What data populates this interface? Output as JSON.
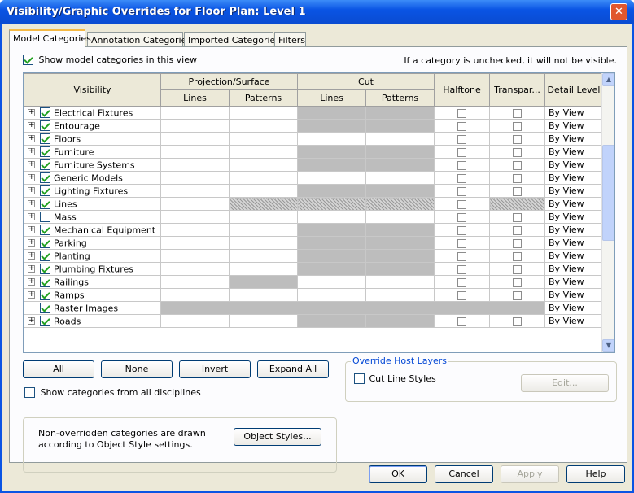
{
  "window": {
    "title": "Visibility/Graphic Overrides for Floor Plan: Level 1",
    "close_glyph": "✕"
  },
  "tabs": [
    "Model Categories",
    "Annotation Categories",
    "Imported Categories",
    "Filters"
  ],
  "show_model": {
    "label": "Show model categories in this view",
    "checked": true
  },
  "hint": "If a category is unchecked, it will not be visible.",
  "headers": {
    "visibility": "Visibility",
    "projection_surface": "Projection/Surface",
    "cut": "Cut",
    "lines": "Lines",
    "patterns": "Patterns",
    "halftone": "Halftone",
    "transparency": "Transpar...",
    "detail_level": "Detail Level"
  },
  "rows": [
    {
      "name": "Electrical Fixtures",
      "checked": true,
      "expand": true,
      "cut": "gray",
      "proj_pat": "",
      "halftone": true,
      "transp": true,
      "detail": "By View"
    },
    {
      "name": "Entourage",
      "checked": true,
      "expand": true,
      "cut": "gray",
      "proj_pat": "",
      "halftone": true,
      "transp": true,
      "detail": "By View"
    },
    {
      "name": "Floors",
      "checked": true,
      "expand": true,
      "cut": "",
      "proj_pat": "",
      "halftone": true,
      "transp": true,
      "detail": "By View"
    },
    {
      "name": "Furniture",
      "checked": true,
      "expand": true,
      "cut": "gray",
      "proj_pat": "",
      "halftone": true,
      "transp": true,
      "detail": "By View"
    },
    {
      "name": "Furniture Systems",
      "checked": true,
      "expand": true,
      "cut": "gray",
      "proj_pat": "",
      "halftone": true,
      "transp": true,
      "detail": "By View"
    },
    {
      "name": "Generic Models",
      "checked": true,
      "expand": true,
      "cut": "",
      "proj_pat": "",
      "halftone": true,
      "transp": true,
      "detail": "By View"
    },
    {
      "name": "Lighting Fixtures",
      "checked": true,
      "expand": true,
      "cut": "gray",
      "proj_pat": "",
      "halftone": true,
      "transp": true,
      "detail": "By View"
    },
    {
      "name": "Lines",
      "checked": true,
      "expand": true,
      "cut": "hatch",
      "proj_pat": "hatch",
      "halftone": true,
      "transp": false,
      "transp_hatch": true,
      "detail": "By View"
    },
    {
      "name": "Mass",
      "checked": false,
      "expand": true,
      "cut": "",
      "proj_pat": "",
      "halftone": true,
      "transp": true,
      "detail": "By View",
      "selected": true
    },
    {
      "name": "Mechanical Equipment",
      "checked": true,
      "expand": true,
      "cut": "gray",
      "proj_pat": "",
      "halftone": true,
      "transp": true,
      "detail": "By View"
    },
    {
      "name": "Parking",
      "checked": true,
      "expand": true,
      "cut": "gray",
      "proj_pat": "",
      "halftone": true,
      "transp": true,
      "detail": "By View"
    },
    {
      "name": "Planting",
      "checked": true,
      "expand": true,
      "cut": "gray",
      "proj_pat": "",
      "halftone": true,
      "transp": true,
      "detail": "By View"
    },
    {
      "name": "Plumbing Fixtures",
      "checked": true,
      "expand": true,
      "cut": "gray",
      "proj_pat": "",
      "halftone": true,
      "transp": true,
      "detail": "By View"
    },
    {
      "name": "Railings",
      "checked": true,
      "expand": true,
      "cut": "",
      "proj_pat": "gray",
      "halftone": true,
      "transp": true,
      "detail": "By View"
    },
    {
      "name": "Ramps",
      "checked": true,
      "expand": true,
      "cut": "",
      "proj_pat": "",
      "halftone": true,
      "transp": true,
      "detail": "By View"
    },
    {
      "name": "Raster Images",
      "checked": true,
      "expand": false,
      "raster": true,
      "detail": "By View"
    },
    {
      "name": "Roads",
      "checked": true,
      "expand": true,
      "cut": "gray",
      "proj_pat": "",
      "halftone": true,
      "transp": true,
      "detail": "By View"
    }
  ],
  "buttons": {
    "all": "All",
    "none": "None",
    "invert": "Invert",
    "expand_all": "Expand All"
  },
  "show_all_disciplines": {
    "label": "Show categories from all disciplines",
    "checked": false
  },
  "override_host": {
    "title": "Override Host Layers",
    "cut_line_styles": "Cut Line Styles",
    "edit": "Edit..."
  },
  "note": {
    "text": "Non-overridden categories are drawn according to Object Style settings.",
    "button": "Object Styles..."
  },
  "footer": {
    "ok": "OK",
    "cancel": "Cancel",
    "apply": "Apply",
    "help": "Help"
  }
}
